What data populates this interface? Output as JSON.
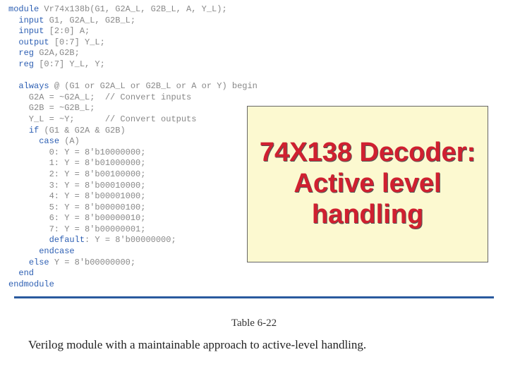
{
  "code": {
    "lines": [
      {
        "indent": 0,
        "kw": "module",
        "rest": " Vr74x138b(G1, G2A_L, G2B_L, A, Y_L);"
      },
      {
        "indent": 1,
        "kw": "input",
        "rest": " G1, G2A_L, G2B_L;"
      },
      {
        "indent": 1,
        "kw": "input",
        "rest": " [2:0] A;"
      },
      {
        "indent": 1,
        "kw": "output",
        "rest": " [0:7] Y_L;"
      },
      {
        "indent": 1,
        "kw": "reg",
        "rest": " G2A,G2B;"
      },
      {
        "indent": 1,
        "kw": "reg",
        "rest": " [0:7] Y_L, Y;"
      },
      {
        "indent": 0,
        "kw": "",
        "rest": ""
      },
      {
        "indent": 1,
        "kw": "always",
        "rest": " @ (G1 or G2A_L or G2B_L or A or Y) begin"
      },
      {
        "indent": 2,
        "kw": "",
        "rest": "G2A = ~G2A_L;  // Convert inputs"
      },
      {
        "indent": 2,
        "kw": "",
        "rest": "G2B = ~G2B_L;"
      },
      {
        "indent": 2,
        "kw": "",
        "rest": "Y_L = ~Y;      // Convert outputs"
      },
      {
        "indent": 2,
        "kw": "if",
        "rest": " (G1 & G2A & G2B)"
      },
      {
        "indent": 3,
        "kw": "case",
        "rest": " (A)"
      },
      {
        "indent": 4,
        "kw": "",
        "rest": "0: Y = 8'b10000000;"
      },
      {
        "indent": 4,
        "kw": "",
        "rest": "1: Y = 8'b01000000;"
      },
      {
        "indent": 4,
        "kw": "",
        "rest": "2: Y = 8'b00100000;"
      },
      {
        "indent": 4,
        "kw": "",
        "rest": "3: Y = 8'b00010000;"
      },
      {
        "indent": 4,
        "kw": "",
        "rest": "4: Y = 8'b00001000;"
      },
      {
        "indent": 4,
        "kw": "",
        "rest": "5: Y = 8'b00000100;"
      },
      {
        "indent": 4,
        "kw": "",
        "rest": "6: Y = 8'b00000010;"
      },
      {
        "indent": 4,
        "kw": "",
        "rest": "7: Y = 8'b00000001;"
      },
      {
        "indent": 4,
        "kw": "default",
        "rest": ": Y = 8'b00000000;"
      },
      {
        "indent": 3,
        "kw": "endcase",
        "rest": ""
      },
      {
        "indent": 2,
        "kw": "else",
        "rest": " Y = 8'b00000000;"
      },
      {
        "indent": 1,
        "kw": "end",
        "rest": ""
      },
      {
        "indent": 0,
        "kw": "endmodule",
        "rest": ""
      }
    ]
  },
  "callout": {
    "text": "74X138 Decoder: Active level handling"
  },
  "caption": {
    "label": "Table 6-22",
    "text": "Verilog module with a maintainable approach to active-level handling."
  }
}
